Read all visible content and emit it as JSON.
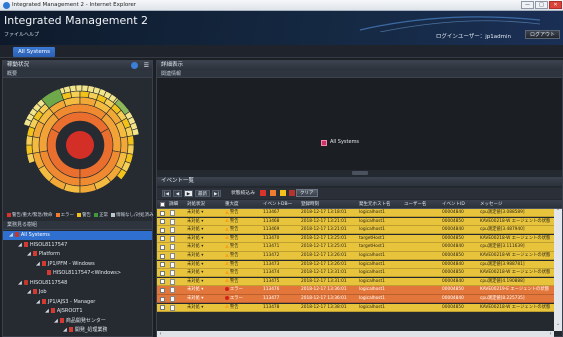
{
  "window": {
    "title": "Integrated Management 2 - Internet Explorer",
    "min": "—",
    "max": "□",
    "close": "✕"
  },
  "header": {
    "app_title": "Integrated Management 2",
    "menu": [
      "ファイル",
      "ヘルプ"
    ],
    "login_user": "ログインユーザー：jp1admin",
    "logout": "ログアウト"
  },
  "tabs": {
    "all_systems": "All Systems"
  },
  "left": {
    "panel_title": "稼動状況",
    "overview_label": "概要",
    "legend": [
      {
        "label": "警告/重大/緊急/致命",
        "color": "#d9332b"
      },
      {
        "label": "エラー",
        "color": "#ef7d2f"
      },
      {
        "label": "警告",
        "color": "#f2c21a"
      },
      {
        "label": "正常",
        "color": "#3f9a3a"
      },
      {
        "label": "情報なし/対処済み",
        "color": "#bfc5cc"
      }
    ],
    "tree_title": "業務見る樹組",
    "tree": [
      {
        "label": "All Systems",
        "indent": 0,
        "selected": true,
        "icon": "server"
      },
      {
        "label": "HISOL8117547",
        "indent": 1,
        "icon": "alert"
      },
      {
        "label": "Platform",
        "indent": 2,
        "icon": "alert"
      },
      {
        "label": "JP1/PFM - Windows",
        "indent": 3,
        "icon": "alert"
      },
      {
        "label": "HISOL8117547<Windows>",
        "indent": 4,
        "icon": "alert"
      },
      {
        "label": "HISOL8117548",
        "indent": 1,
        "icon": "server"
      },
      {
        "label": "Job",
        "indent": 2,
        "icon": "alert"
      },
      {
        "label": "JP1/AJS3 - Manager",
        "indent": 3,
        "icon": "alert"
      },
      {
        "label": "AJSROOT1",
        "indent": 4,
        "icon": "alert"
      },
      {
        "label": "商品開発センター",
        "indent": 5,
        "icon": "alert"
      },
      {
        "label": "開発_処理業務",
        "indent": 6,
        "icon": "alert"
      }
    ]
  },
  "right": {
    "panel_title": "詳細表示",
    "sub_label": "関連情報",
    "mini_label": "All Systems",
    "events_title": "イベント一覧",
    "toolbar": {
      "refresh": "最新",
      "filter_label": "状態絞込み",
      "clear": "クリア",
      "nav_first": "|◀",
      "nav_prev": "◀",
      "nav_next": "▶",
      "nav_last": "▶|"
    },
    "columns": [
      "詳細",
      "対処状況",
      "重大度",
      "イベントDB一",
      "登録時刻",
      "発生元ホスト名",
      "ユーザー名",
      "イベントID",
      "メッセージ"
    ],
    "rows": [
      {
        "status": "未対処",
        "sev": "警告",
        "db": "113467",
        "time": "2018-12-17 13:18:01",
        "host": "logicalhost1",
        "user": "",
        "eid": "00004840",
        "msg": "cpu測定値[3.088589]",
        "type": "warn"
      },
      {
        "status": "未対処",
        "sev": "警告",
        "db": "113468",
        "time": "2018-12-17 13:21:01",
        "host": "logicalhost1",
        "user": "",
        "eid": "00004850",
        "msg": "KAVE00218-W エージェントの状態",
        "type": "warn"
      },
      {
        "status": "未対処",
        "sev": "警告",
        "db": "113469",
        "time": "2018-12-17 13:21:01",
        "host": "logicalhost1",
        "user": "",
        "eid": "00004840",
        "msg": "cpu測定値[3.487940]",
        "type": "warn"
      },
      {
        "status": "未対処",
        "sev": "警告",
        "db": "113470",
        "time": "2018-12-17 13:25:01",
        "host": "targetHost1",
        "user": "",
        "eid": "00004850",
        "msg": "KAVE00218-W エージェントの状態",
        "type": "warn"
      },
      {
        "status": "未対処",
        "sev": "警告",
        "db": "113471",
        "time": "2018-12-17 13:25:01",
        "host": "targetHost1",
        "user": "",
        "eid": "00004840",
        "msg": "cpu測定値[3.111639]",
        "type": "warn"
      },
      {
        "status": "未対処",
        "sev": "警告",
        "db": "113472",
        "time": "2018-12-17 13:26:01",
        "host": "logicalhost1",
        "user": "",
        "eid": "00004850",
        "msg": "KAVE00218-W エージェントの状態",
        "type": "warn"
      },
      {
        "status": "未対処",
        "sev": "警告",
        "db": "113473",
        "time": "2018-12-17 13:26:01",
        "host": "logicalhost1",
        "user": "",
        "eid": "00004840",
        "msg": "cpu測定値[3.988781]",
        "type": "warn"
      },
      {
        "status": "未対処",
        "sev": "警告",
        "db": "113474",
        "time": "2018-12-17 13:31:01",
        "host": "logicalhost1",
        "user": "",
        "eid": "00004850",
        "msg": "KAVE00218-W エージェントの状態",
        "type": "warn"
      },
      {
        "status": "未対処",
        "sev": "警告",
        "db": "113475",
        "time": "2018-12-17 13:31:01",
        "host": "logicalhost1",
        "user": "",
        "eid": "00004840",
        "msg": "cpu測定値[4.190888]",
        "type": "warn"
      },
      {
        "status": "未対処",
        "sev": "エラー",
        "db": "113476",
        "time": "2018-12-17 13:36:01",
        "host": "logicalhost1",
        "user": "",
        "eid": "00004850",
        "msg": "KAVE00219-E エージェントの状態",
        "type": "err"
      },
      {
        "status": "未対処",
        "sev": "エラー",
        "db": "113477",
        "time": "2018-12-17 13:36:01",
        "host": "logicalhost1",
        "user": "",
        "eid": "00004840",
        "msg": "cpu測定値[8.225735]",
        "type": "err"
      },
      {
        "status": "未対処",
        "sev": "警告",
        "db": "113478",
        "time": "2018-12-17 13:38:01",
        "host": "logicalhost1",
        "user": "",
        "eid": "00004850",
        "msg": "KAVE00218-W エージェントの状態",
        "type": "warn"
      }
    ]
  }
}
